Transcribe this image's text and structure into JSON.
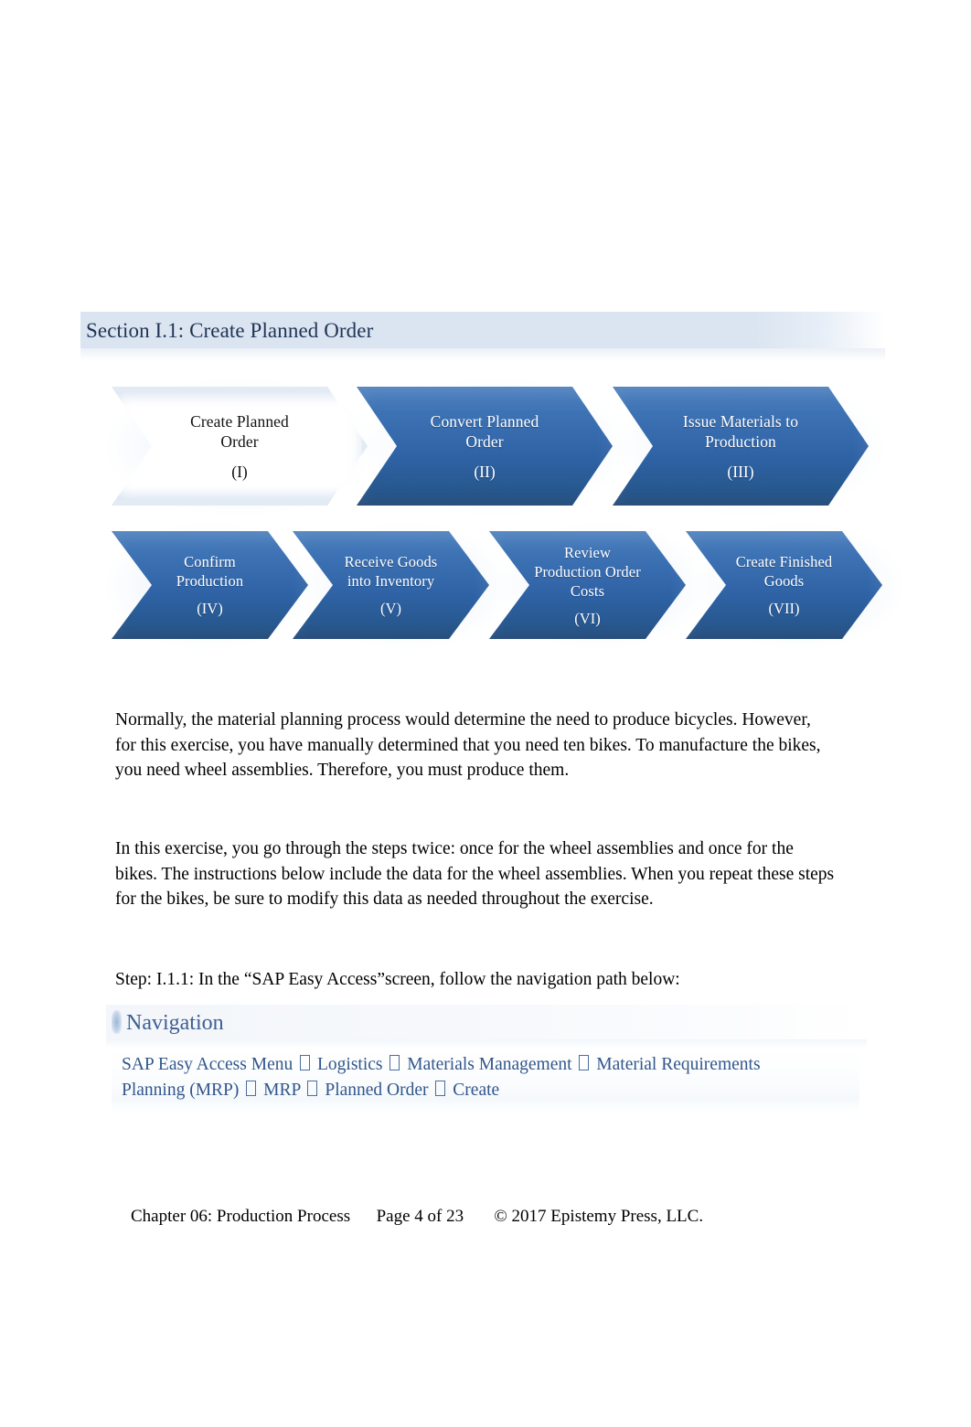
{
  "section": {
    "header_title": "Section I.1: Create Planned Order"
  },
  "process_diagram": {
    "row1": [
      {
        "title_line1": "Create Planned",
        "title_line2": "Order",
        "numeral": "(I)",
        "state": "current"
      },
      {
        "title_line1": "Convert Planned",
        "title_line2": "Order",
        "numeral": "(II)",
        "state": "upcoming"
      },
      {
        "title_line1": "Issue Materials to",
        "title_line2": "Production",
        "numeral": "(III)",
        "state": "upcoming"
      }
    ],
    "row2": [
      {
        "title_line1": "Confirm",
        "title_line2": "Production",
        "title_line3": "",
        "numeral": "(IV)",
        "state": "upcoming"
      },
      {
        "title_line1": "Receive Goods",
        "title_line2": "into Inventory",
        "title_line3": "",
        "numeral": "(V)",
        "state": "upcoming"
      },
      {
        "title_line1": "Review",
        "title_line2": "Production Order",
        "title_line3": "Costs",
        "numeral": "(VI)",
        "state": "upcoming"
      },
      {
        "title_line1": "Create Finished",
        "title_line2": "Goods",
        "title_line3": "",
        "numeral": "(VII)",
        "state": "upcoming"
      }
    ]
  },
  "body": {
    "paragraph_1": "Normally, the material planning process would determine the need to produce bicycles.    However, for this exercise, you have manually determined that you need ten bikes. To manufacture the bikes, you need wheel assemblies. Therefore, you must produce them.",
    "paragraph_2": "In this exercise, you go through the steps twice: once for the wheel assemblies and once for the bikes. The instructions below include the data for the wheel assemblies. When you repeat these steps for the bikes, be sure to modify this data as needed throughout the exercise.",
    "step_line": "Step: I.1.1: In the “SAP Easy Access”screen, follow the navigation path below:"
  },
  "navigation": {
    "header_title": "Navigation",
    "path_items": [
      "SAP Easy Access Menu",
      "Logistics",
      "Materials Management",
      "Material Requirements Planning (MRP)",
      "MRP",
      "Planned Order",
      "Create"
    ],
    "separator_glyph": "missing-glyph-box"
  },
  "footer": {
    "chapter": "Chapter 06: Production Process",
    "page": "Page 4 of 23",
    "copyright": "© 2017 Epistemy Press, LLC.",
    "full_text": "Chapter 06: Production Process      Page 4 of 23       © 2017 Epistemy Press, LLC."
  },
  "colors": {
    "header_bar": "#dbe5f1",
    "header_text": "#1f3355",
    "chevron_blue": "#3d72b4",
    "chevron_blue_dark": "#1f4a7d",
    "nav_title": "#3c5f93",
    "nav_path_text": "#31568d"
  }
}
